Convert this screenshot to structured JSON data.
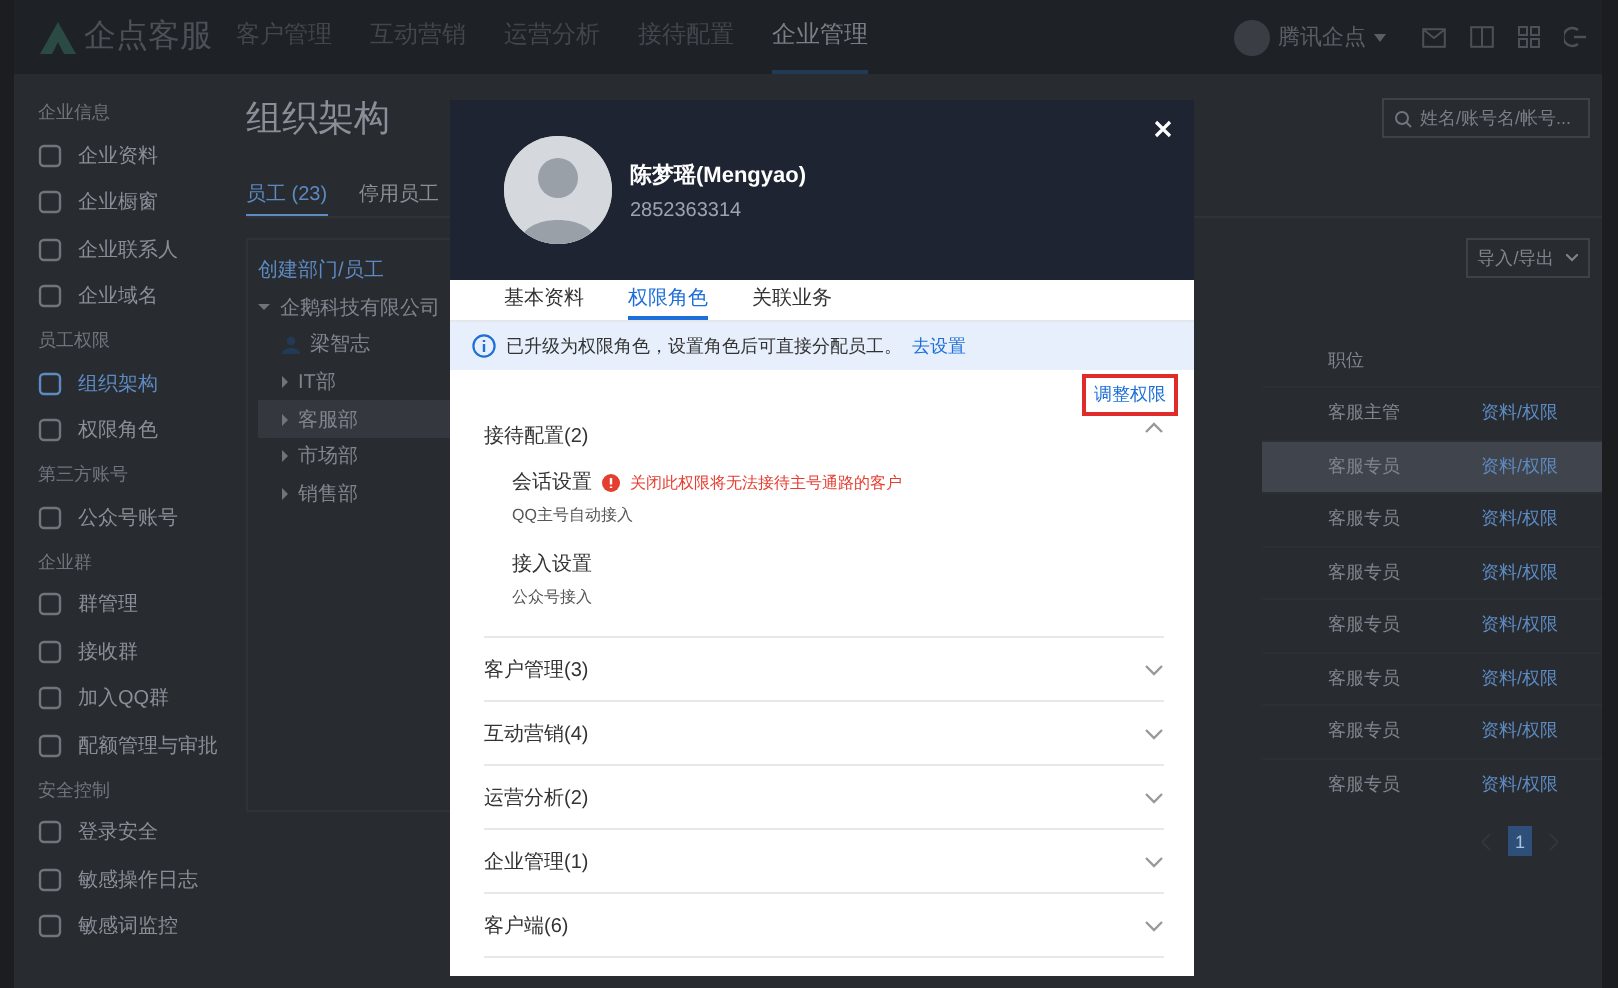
{
  "topbar": {
    "logo": "企点客服",
    "nav": [
      {
        "label": "客户管理",
        "selected": false
      },
      {
        "label": "互动营销",
        "selected": false
      },
      {
        "label": "运营分析",
        "selected": false
      },
      {
        "label": "接待配置",
        "selected": false
      },
      {
        "label": "企业管理",
        "selected": true
      }
    ],
    "account": "腾讯企点"
  },
  "sidebar": {
    "sections": [
      {
        "title": "企业信息",
        "items": [
          {
            "label": "企业资料",
            "selected": false
          },
          {
            "label": "企业橱窗",
            "selected": false
          },
          {
            "label": "企业联系人",
            "selected": false
          },
          {
            "label": "企业域名",
            "selected": false
          }
        ]
      },
      {
        "title": "员工权限",
        "items": [
          {
            "label": "组织架构",
            "selected": true
          },
          {
            "label": "权限角色",
            "selected": false
          }
        ]
      },
      {
        "title": "第三方账号",
        "items": [
          {
            "label": "公众号账号",
            "selected": false
          }
        ]
      },
      {
        "title": "企业群",
        "items": [
          {
            "label": "群管理",
            "selected": false
          },
          {
            "label": "接收群",
            "selected": false
          },
          {
            "label": "加入QQ群",
            "selected": false
          },
          {
            "label": "配额管理与审批",
            "selected": false
          }
        ]
      },
      {
        "title": "安全控制",
        "items": [
          {
            "label": "登录安全",
            "selected": false
          },
          {
            "label": "敏感操作日志",
            "selected": false
          },
          {
            "label": "敏感词监控",
            "selected": false
          }
        ]
      }
    ]
  },
  "page": {
    "title": "组织架构",
    "search": {
      "placeholder": "姓名/账号名/帐号..."
    },
    "tabs": [
      {
        "label": "员工 (23)",
        "selected": true
      },
      {
        "label": "停用员工",
        "selected": false
      }
    ],
    "tree": {
      "create": "创建部门/员工",
      "root": {
        "label": "企鹅科技有限公司",
        "expanded": true,
        "children": [
          {
            "label": "梁智志",
            "kind": "person",
            "selected": false
          },
          {
            "label": "IT部",
            "kind": "department",
            "selected": false
          },
          {
            "label": "客服部",
            "kind": "department",
            "selected": true
          },
          {
            "label": "市场部",
            "kind": "department",
            "selected": false
          },
          {
            "label": "销售部",
            "kind": "department",
            "selected": false
          }
        ]
      }
    },
    "import_export": "导入/导出",
    "table": {
      "columns": [
        "职位"
      ],
      "rows": [
        {
          "position": "客服主管",
          "action": "资料/权限",
          "selected": false
        },
        {
          "position": "客服专员",
          "action": "资料/权限",
          "selected": true
        },
        {
          "position": "客服专员",
          "action": "资料/权限",
          "selected": false
        },
        {
          "position": "客服专员",
          "action": "资料/权限",
          "selected": false
        },
        {
          "position": "客服专员",
          "action": "资料/权限",
          "selected": false
        },
        {
          "position": "客服专员",
          "action": "资料/权限",
          "selected": false
        },
        {
          "position": "客服专员",
          "action": "资料/权限",
          "selected": false
        },
        {
          "position": "客服专员",
          "action": "资料/权限",
          "selected": false
        }
      ]
    },
    "pagination": [
      {
        "label": "1",
        "selected": true
      }
    ]
  },
  "dialog": {
    "name": "陈梦瑶(Mengyao)",
    "account": "2852363314",
    "tabs": [
      {
        "label": "基本资料",
        "selected": false
      },
      {
        "label": "权限角色",
        "selected": true
      },
      {
        "label": "关联业务",
        "selected": false
      }
    ],
    "notice": {
      "text": "已升级为权限角色，设置角色后可直接分配员工。",
      "link": "去设置"
    },
    "adjust_button": "调整权限",
    "groups": [
      {
        "title": "接待配置(2)",
        "expanded": true,
        "items": [
          {
            "name": "会话设置",
            "warning": "关闭此权限将无法接待主号通路的客户",
            "value": "QQ主号自动接入"
          },
          {
            "name": "接入设置",
            "value": "公众号接入"
          }
        ]
      },
      {
        "title": "客户管理(3)",
        "expanded": false
      },
      {
        "title": "互动营销(4)",
        "expanded": false
      },
      {
        "title": "运营分析(2)",
        "expanded": false
      },
      {
        "title": "企业管理(1)",
        "expanded": false
      },
      {
        "title": "客户端(6)",
        "expanded": false
      }
    ]
  }
}
